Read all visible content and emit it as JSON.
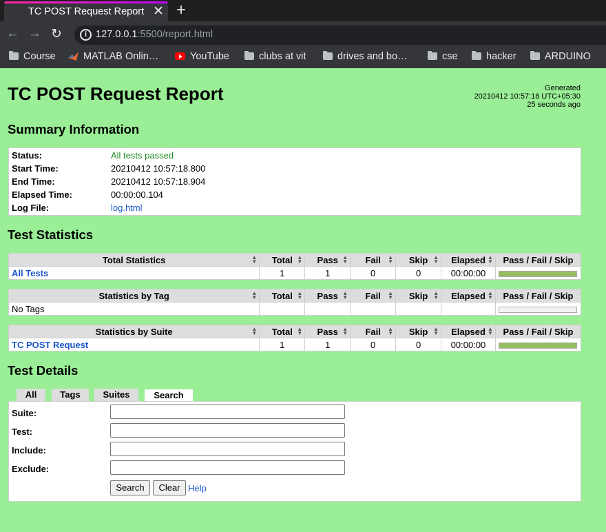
{
  "browser": {
    "tab_title": "TC POST Request Report",
    "url_host": "127.0.0.1",
    "url_rest": ":5500/report.html",
    "bookmarks": [
      "Course",
      "MATLAB Onlin…",
      "YouTube",
      "clubs at vit",
      "drives and bo…",
      "cse",
      "hacker",
      "ARDUINO"
    ]
  },
  "report": {
    "title": "TC POST Request Report",
    "generated_label": "Generated",
    "generated_time": "20210412 10:57:18 UTC+05:30",
    "generated_ago": "25 seconds ago"
  },
  "summary": {
    "heading": "Summary Information",
    "rows": [
      {
        "label": "Status:",
        "value": "All tests passed"
      },
      {
        "label": "Start Time:",
        "value": "20210412 10:57:18.800"
      },
      {
        "label": "End Time:",
        "value": "20210412 10:57:18.904"
      },
      {
        "label": "Elapsed Time:",
        "value": "00:00:00.104"
      },
      {
        "label": "Log File:",
        "value": "log.html"
      }
    ]
  },
  "statistics": {
    "heading": "Test Statistics",
    "columns": [
      "Total",
      "Pass",
      "Fail",
      "Skip",
      "Elapsed",
      "Pass / Fail / Skip"
    ],
    "total": {
      "header": "Total Statistics",
      "row": {
        "name": "All Tests",
        "total": "1",
        "pass": "1",
        "fail": "0",
        "skip": "0",
        "elapsed": "00:00:00",
        "pass_fraction": 1
      }
    },
    "tag": {
      "header": "Statistics by Tag",
      "row": {
        "name": "No Tags",
        "pass_fraction": 0
      }
    },
    "suite": {
      "header": "Statistics by Suite",
      "row": {
        "name": "TC POST Request",
        "total": "1",
        "pass": "1",
        "fail": "0",
        "skip": "0",
        "elapsed": "00:00:00",
        "pass_fraction": 1
      }
    }
  },
  "details": {
    "heading": "Test Details",
    "tabs": [
      "All",
      "Tags",
      "Suites",
      "Search"
    ],
    "active_tab": "Search",
    "fields": [
      {
        "label": "Suite:",
        "value": ""
      },
      {
        "label": "Test:",
        "value": ""
      },
      {
        "label": "Include:",
        "value": ""
      },
      {
        "label": "Exclude:",
        "value": ""
      }
    ],
    "search_button": "Search",
    "clear_button": "Clear",
    "help_link": "Help"
  }
}
